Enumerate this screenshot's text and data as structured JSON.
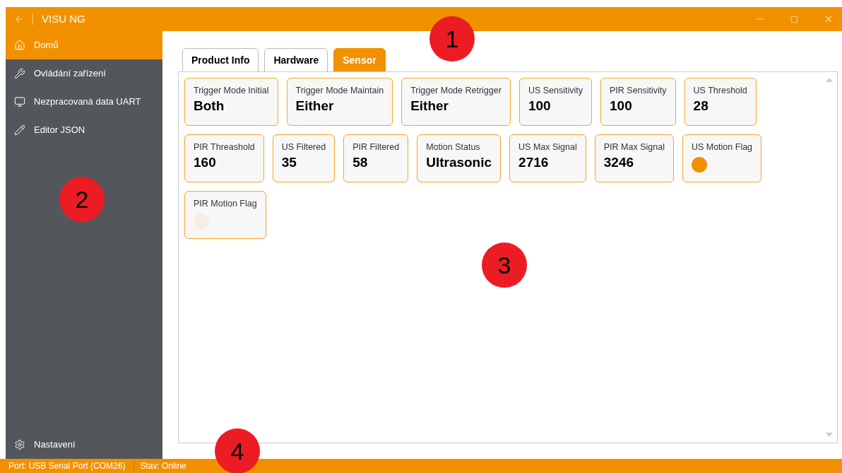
{
  "window": {
    "title": "VISU NG"
  },
  "sidebar": {
    "items": [
      {
        "label": "Domů",
        "selected": true
      },
      {
        "label": "Ovládání zařízení",
        "selected": false
      },
      {
        "label": "Nezpracovaná data UART",
        "selected": false
      },
      {
        "label": "Editor JSON",
        "selected": false
      }
    ],
    "footer": {
      "label": "Nastavení",
      "selected": false
    }
  },
  "tabs": [
    {
      "label": "Product Info",
      "selected": false
    },
    {
      "label": "Hardware",
      "selected": false
    },
    {
      "label": "Sensor",
      "selected": true
    }
  ],
  "tiles": [
    {
      "kind": "value",
      "label": "Trigger Mode Initial",
      "value": "Both"
    },
    {
      "kind": "value",
      "label": "Trigger Mode Maintain",
      "value": "Either"
    },
    {
      "kind": "value",
      "label": "Trigger Mode Retrigger",
      "value": "Either"
    },
    {
      "kind": "value",
      "label": "US Sensitivity",
      "value": "100"
    },
    {
      "kind": "value",
      "label": "PIR Sensitivity",
      "value": "100"
    },
    {
      "kind": "value",
      "label": "US Threshold",
      "value": "28"
    },
    {
      "kind": "value",
      "label": "PIR Threashold",
      "value": "160"
    },
    {
      "kind": "value",
      "label": "US Filtered",
      "value": "35"
    },
    {
      "kind": "value",
      "label": "PIR Filtered",
      "value": "58"
    },
    {
      "kind": "value",
      "label": "Motion Status",
      "value": "Ultrasonic"
    },
    {
      "kind": "value",
      "label": "US Max Signal",
      "value": "2716"
    },
    {
      "kind": "value",
      "label": "PIR Max Signal",
      "value": "3246"
    },
    {
      "kind": "flag",
      "label": "US Motion Flag",
      "on": true
    },
    {
      "kind": "flag",
      "label": "PIR Motion Flag",
      "on": false
    }
  ],
  "status_bar": {
    "port": "Port: USB Serial Port (COM26)",
    "state": "Stav: Online"
  },
  "callouts": [
    "1",
    "2",
    "3",
    "4"
  ]
}
